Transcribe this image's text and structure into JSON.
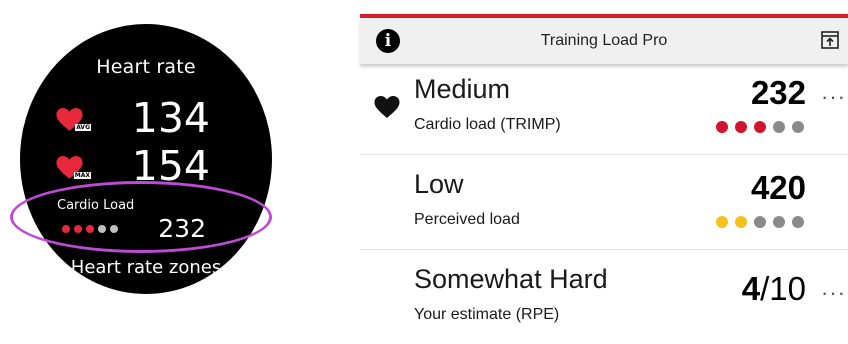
{
  "watch": {
    "title": "Heart rate",
    "avg": {
      "tag": "AVG",
      "value": "134"
    },
    "max": {
      "tag": "MAX",
      "value": "154"
    },
    "cardio": {
      "label": "Cardio Load",
      "value": "232",
      "dots": [
        "#e8293c",
        "#e8293c",
        "#e8293c",
        "#bfbfbf",
        "#bfbfbf"
      ]
    },
    "zones_label": "Heart rate zones",
    "highlight_color": "#c04ad8"
  },
  "app": {
    "title": "Training Load Pro",
    "accent_color": "#d41f2f",
    "header_icons": {
      "left": "info-icon",
      "right": "export-icon"
    },
    "rows": [
      {
        "icon": "heart-icon",
        "title": "Medium",
        "subtitle": "Cardio load (TRIMP)",
        "value": "232",
        "menu": "···",
        "dots": [
          "#d0142c",
          "#d0142c",
          "#d0142c",
          "#8a8a8a",
          "#8a8a8a"
        ]
      },
      {
        "icon": "",
        "title": "Low",
        "subtitle": "Perceived load",
        "value": "420",
        "menu": "",
        "dots": [
          "#f4c21f",
          "#f4c21f",
          "#8a8a8a",
          "#8a8a8a",
          "#8a8a8a"
        ]
      },
      {
        "icon": "",
        "title": "Somewhat Hard",
        "subtitle": "Your estimate (RPE)",
        "value_main": "4",
        "value_rest": "/10",
        "menu": "···",
        "dots": []
      }
    ]
  }
}
